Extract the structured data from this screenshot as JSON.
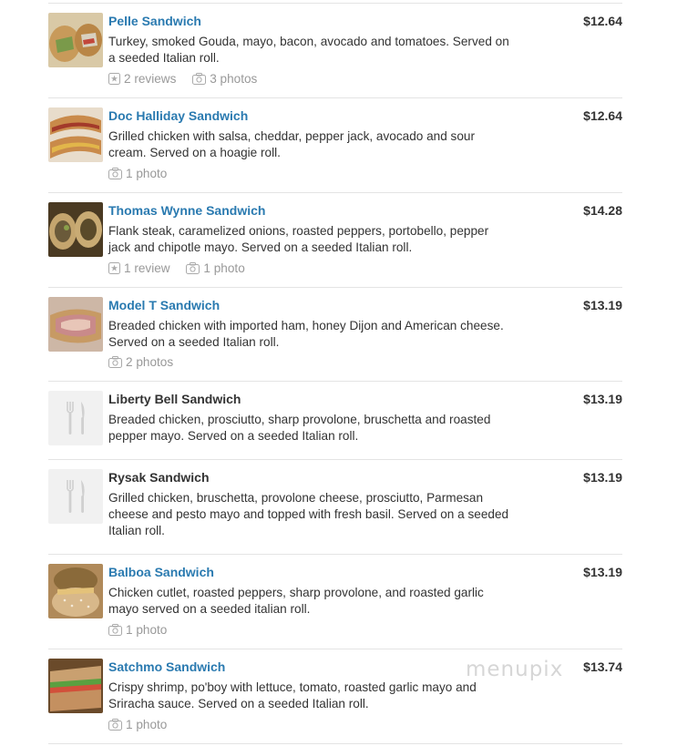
{
  "items": [
    {
      "name": "Pelle Sandwich",
      "price": "$12.64",
      "description": "Turkey, smoked Gouda, mayo, bacon, avocado and tomatoes. Served on a seeded Italian roll.",
      "reviews": "2 reviews",
      "photos": "3 photos",
      "thumb": "sandwich-photo"
    },
    {
      "name": "Doc Halliday Sandwich",
      "price": "$12.64",
      "description": "Grilled chicken with salsa, cheddar, pepper jack, avocado and sour cream. Served on a hoagie roll.",
      "photos": "1 photo",
      "thumb": "sandwich-photo"
    },
    {
      "name": "Thomas Wynne Sandwich",
      "price": "$14.28",
      "description": "Flank steak, caramelized onions, roasted peppers, portobello, pepper jack and chipotle mayo. Served on a seeded Italian roll.",
      "reviews": "1 review",
      "photos": "1 photo",
      "thumb": "sandwich-photo"
    },
    {
      "name": "Model T Sandwich",
      "price": "$13.19",
      "description": "Breaded chicken with imported ham, honey Dijon and American cheese. Served on a seeded Italian roll.",
      "photos": "2 photos",
      "thumb": "sandwich-photo"
    },
    {
      "name": "Liberty Bell Sandwich",
      "price": "$13.19",
      "description": "Breaded chicken, prosciutto, sharp provolone, bruschetta and roasted pepper mayo. Served on a seeded Italian roll.",
      "thumb": "fork-knife-placeholder-icon"
    },
    {
      "name": "Rysak Sandwich",
      "price": "$13.19",
      "description": "Grilled chicken, bruschetta, provolone cheese, prosciutto, Parmesan cheese and pesto mayo and topped with fresh basil. Served on a seeded Italian roll.",
      "thumb": "fork-knife-placeholder-icon"
    },
    {
      "name": "Balboa Sandwich",
      "price": "$13.19",
      "description": "Chicken cutlet, roasted peppers, sharp provolone, and roasted garlic mayo served on a seeded italian roll.",
      "photos": "1 photo",
      "thumb": "sandwich-photo"
    },
    {
      "name": "Satchmo Sandwich",
      "price": "$13.74",
      "description": "Crispy shrimp, po'boy with lettuce, tomato, roasted garlic mayo and Sriracha sauce. Served on a seeded Italian roll.",
      "photos": "1 photo",
      "thumb": "sandwich-photo"
    }
  ],
  "watermark": "menupix",
  "colors": {
    "link": "#2a7ab0",
    "text": "#333333",
    "muted": "#999999",
    "divider": "#e4e4e4"
  }
}
